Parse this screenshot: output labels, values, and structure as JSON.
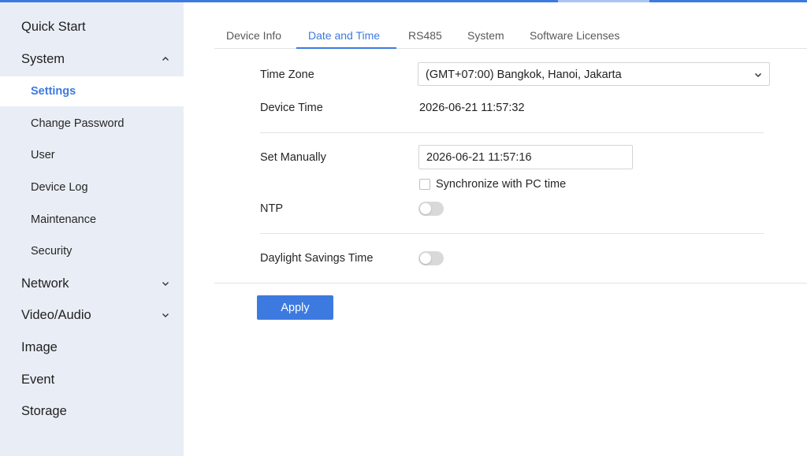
{
  "sidebar": {
    "quick_start": "Quick Start",
    "system": "System",
    "system_items": [
      "Settings",
      "Change Password",
      "User",
      "Device Log",
      "Maintenance",
      "Security"
    ],
    "network": "Network",
    "video_audio": "Video/Audio",
    "image": "Image",
    "event": "Event",
    "storage": "Storage"
  },
  "tabs": [
    "Device Info",
    "Date and Time",
    "RS485",
    "System",
    "Software Licenses"
  ],
  "form": {
    "time_zone_label": "Time Zone",
    "time_zone_value": "(GMT+07:00) Bangkok, Hanoi, Jakarta",
    "device_time_label": "Device Time",
    "device_time_value": "2026-06-21 11:57:32",
    "set_manually_label": "Set Manually",
    "set_manually_value": "2026-06-21 11:57:16",
    "sync_pc_label": "Synchronize with PC time",
    "sync_pc_checked": false,
    "ntp_label": "NTP",
    "ntp_enabled": false,
    "dst_label": "Daylight Savings Time",
    "dst_enabled": false
  },
  "apply_label": "Apply",
  "colors": {
    "accent": "#3d7ae0",
    "sidebar_bg": "#e9eef6"
  },
  "icons": {
    "expanded": "chevron-up-icon",
    "collapsed": "chevron-down-icon",
    "select": "chevron-down-icon"
  }
}
